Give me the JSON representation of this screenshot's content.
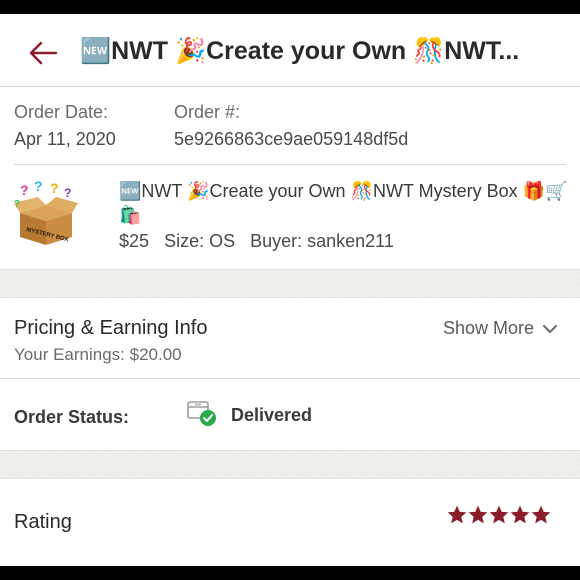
{
  "header": {
    "title": "🆕NWT 🎉Create your Own 🎊NWT..."
  },
  "order": {
    "date_label": "Order Date:",
    "date_value": "Apr 11, 2020",
    "number_label": "Order #:",
    "number_value": "5e9266863ce9ae059148df5d"
  },
  "listing": {
    "title": "🆕NWT 🎉Create your Own 🎊NWT Mystery Box 🎁🛒🛍️",
    "thumbnail_text": "MYSTERY BOX",
    "price": "$25",
    "size": "Size: OS",
    "buyer": "Buyer: sanken211"
  },
  "pricing": {
    "title": "Pricing & Earning Info",
    "earnings": "Your Earnings: $20.00",
    "show_more": "Show More"
  },
  "status": {
    "label": "Order Status:",
    "value": "Delivered"
  },
  "rating": {
    "label": "Rating",
    "stars": 5,
    "max_stars": 5
  },
  "colors": {
    "accent": "#8b1c2b",
    "success": "#2aa84a",
    "band": "#f2f0ed"
  },
  "icons": {
    "back": "arrow-left-icon",
    "show_more": "chevron-down-icon",
    "status": "package-delivered-icon",
    "rating": "star-icon"
  }
}
